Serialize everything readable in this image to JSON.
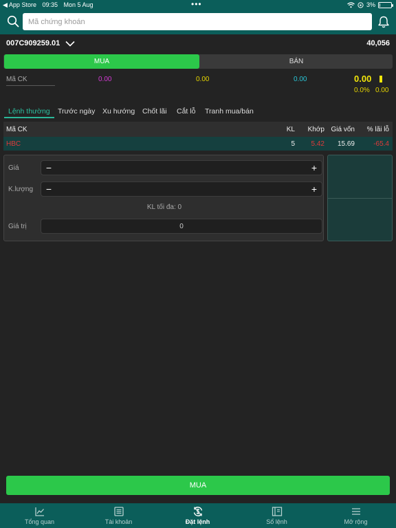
{
  "status_bar": {
    "back_app": "◀ App Store",
    "time": "09:35",
    "date": "Mon 5 Aug",
    "battery": "3%",
    "battery_level": 0.03
  },
  "search": {
    "placeholder": "Mã chứng khoán",
    "value": ""
  },
  "account": {
    "id": "007C909259.01",
    "balance": "40,056"
  },
  "toggle": {
    "buy": "MUA",
    "sell": "BÁN",
    "selected": "buy"
  },
  "quote": {
    "symbol_label": "Mã CK",
    "p1": "0.00",
    "p2": "0.00",
    "p3": "0.00",
    "price": "0.00",
    "pct": "0.0%",
    "change": "0.00"
  },
  "tabs": [
    "Lệnh thường",
    "Trước ngày",
    "Xu hướng",
    "Chốt lãi",
    "Cắt lỗ",
    "Tranh mua/bán"
  ],
  "holdings": {
    "headers": {
      "symbol": "Mã CK",
      "qty": "KL",
      "match": "Khớp",
      "cost": "Giá vốn",
      "pnl": "% lãi lỗ"
    },
    "rows": [
      {
        "symbol": "HBC",
        "qty": "5",
        "match": "5.42",
        "cost": "15.69",
        "pnl": "-65.4"
      }
    ]
  },
  "form": {
    "price_label": "Giá",
    "qty_label": "K.lượng",
    "max_qty": "KL tối đa: 0",
    "value_label": "Giá trị",
    "value": "0",
    "minus": "−",
    "plus": "+"
  },
  "submit": {
    "label": "MUA"
  },
  "nav": [
    {
      "label": "Tổng quan",
      "icon": "chart-line-icon"
    },
    {
      "label": "Tài khoản",
      "icon": "ledger-icon"
    },
    {
      "label": "Đặt lệnh",
      "icon": "dollar-cycle-icon"
    },
    {
      "label": "Sổ lệnh",
      "icon": "book-icon"
    },
    {
      "label": "Mở rộng",
      "icon": "menu-icon"
    }
  ],
  "nav_active": 2,
  "colors": {
    "header": "#0b5e5a",
    "background": "#232323",
    "buy": "#2cc84a",
    "magenta": "#d43ad4",
    "yellow": "#f2e60b",
    "cyan": "#29c5d6",
    "loss": "#e03a3a",
    "row_highlight": "#15403f",
    "tab_active": "#2cc0a0"
  }
}
